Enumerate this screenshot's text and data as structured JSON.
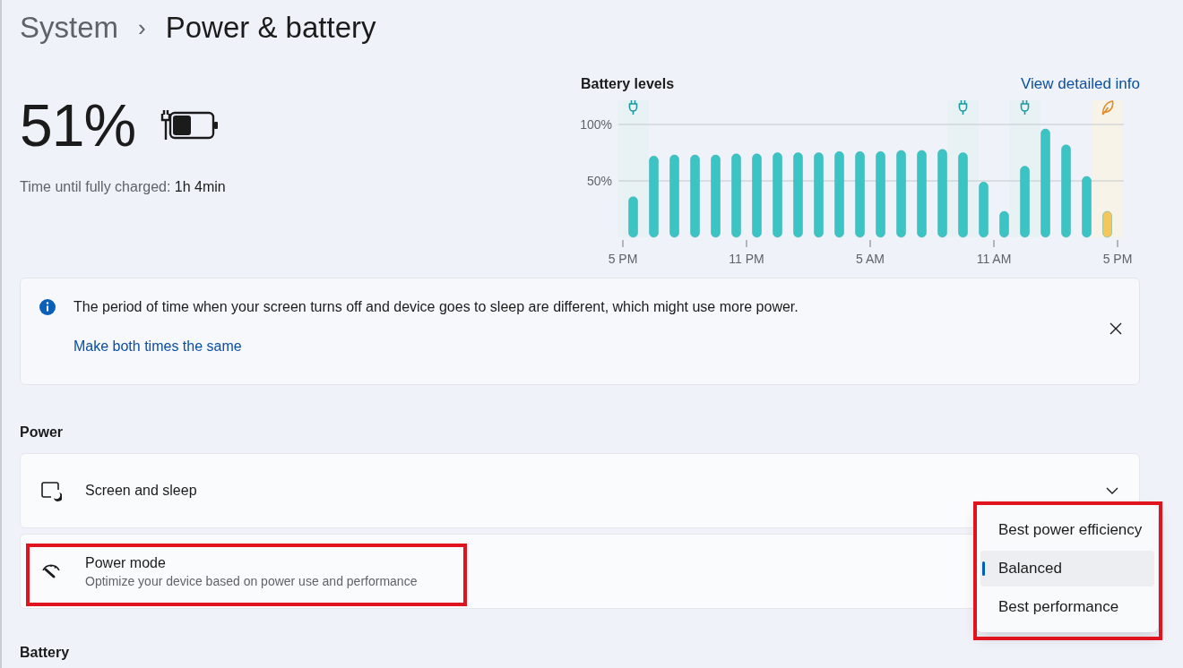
{
  "breadcrumb": {
    "parent": "System",
    "separator": "›",
    "current": "Power & battery"
  },
  "battery": {
    "percent": "51%",
    "charging": true,
    "label": "Time until fully charged:",
    "value": "1h 4min"
  },
  "chart": {
    "link": "View detailed info",
    "columns": [
      {
        "kind": "plug"
      },
      {
        "kind": "plain"
      },
      {
        "kind": "plain"
      },
      {
        "kind": "plain"
      },
      {
        "kind": "plain"
      },
      {
        "kind": "plain"
      },
      {
        "kind": "plain"
      },
      {
        "kind": "plain"
      },
      {
        "kind": "plain"
      },
      {
        "kind": "plain"
      },
      {
        "kind": "plain"
      },
      {
        "kind": "plain"
      },
      {
        "kind": "plain"
      },
      {
        "kind": "plain"
      },
      {
        "kind": "plain"
      },
      {
        "kind": "plain"
      },
      {
        "kind": "plug"
      },
      {
        "kind": "plain"
      },
      {
        "kind": "plain"
      },
      {
        "kind": "plug"
      },
      {
        "kind": "plain"
      },
      {
        "kind": "plain"
      },
      {
        "kind": "plain"
      },
      {
        "kind": "saver"
      },
      {
        "kind": "plain"
      }
    ],
    "chart_data": {
      "type": "bar",
      "title": "Battery levels",
      "categories": [
        "5 PM",
        null,
        null,
        null,
        null,
        null,
        "11 PM",
        null,
        null,
        null,
        null,
        null,
        "5 AM",
        null,
        null,
        null,
        null,
        null,
        "11 AM",
        null,
        null,
        null,
        null,
        null,
        "5 PM"
      ],
      "ylim": [
        0,
        100
      ],
      "yticks": [
        {
          "value": 50,
          "label": "50%"
        },
        {
          "value": 100,
          "label": "100%"
        }
      ],
      "series": [
        {
          "color": "#3cc4c4",
          "values": [
            36,
            72,
            73,
            73,
            73,
            74,
            74,
            75,
            75,
            75,
            76,
            76,
            76,
            77,
            77,
            78,
            75,
            49,
            23,
            63,
            96,
            82,
            54,
            null,
            null
          ]
        },
        {
          "color": "#f5c65a",
          "values": [
            null,
            null,
            null,
            null,
            null,
            null,
            null,
            null,
            null,
            null,
            null,
            null,
            null,
            null,
            null,
            null,
            null,
            null,
            null,
            null,
            null,
            null,
            null,
            23,
            null
          ]
        }
      ]
    }
  },
  "notice": {
    "text": "The period of time when your screen turns off and device goes to sleep are different, which might use more power.",
    "link": "Make both times the same"
  },
  "power": {
    "heading": "Power",
    "items": [
      {
        "kind": "expander",
        "title": "Screen and sleep",
        "expanded": false
      },
      {
        "kind": "dropdown",
        "title": "Power mode",
        "subtitle": "Optimize your device based on power use and performance",
        "options": [
          {
            "label": "Best power efficiency",
            "selected": false
          },
          {
            "label": "Balanced",
            "selected": true
          },
          {
            "label": "Best performance",
            "selected": false
          }
        ]
      }
    ]
  },
  "battery_section": {
    "heading": "Battery"
  }
}
